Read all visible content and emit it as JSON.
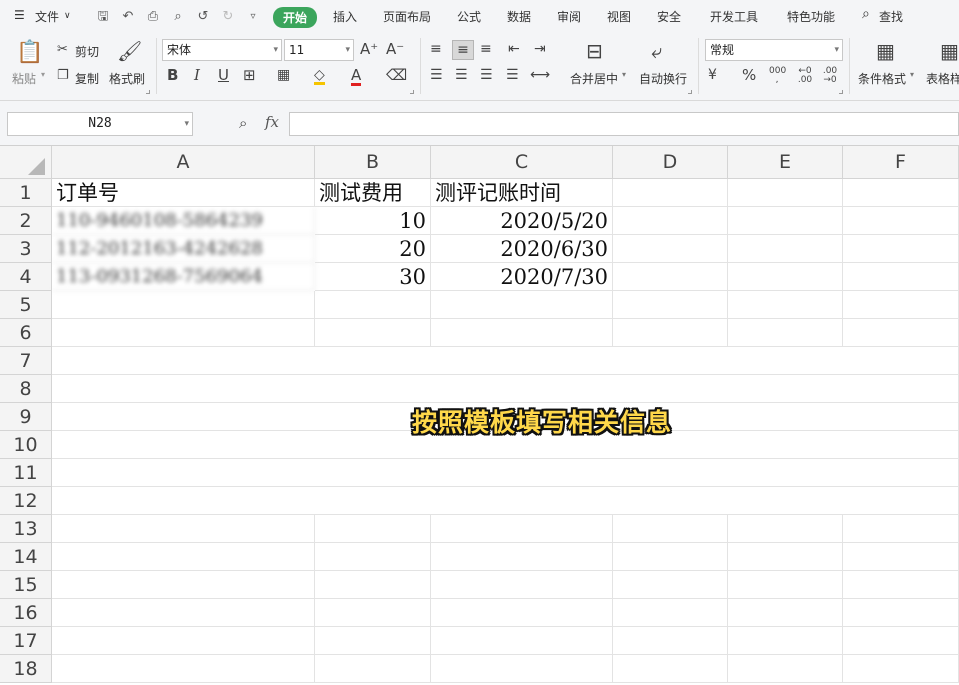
{
  "menu": {
    "file": "文件",
    "tabs": [
      "开始",
      "插入",
      "页面布局",
      "公式",
      "数据",
      "审阅",
      "视图",
      "安全",
      "开发工具",
      "特色功能"
    ],
    "active_tab": "开始",
    "search": "查找"
  },
  "ribbon": {
    "paste": "粘贴",
    "cut": "剪切",
    "copy": "复制",
    "format_painter": "格式刷",
    "font_name": "宋体",
    "font_size": "11",
    "merge_center": "合并居中",
    "wrap_text": "自动换行",
    "number_format": "常规",
    "conditional_format": "条件格式",
    "table_style": "表格样"
  },
  "formula_bar": {
    "name_box": "N28",
    "fx": "fx",
    "formula": ""
  },
  "sheet": {
    "columns": [
      "A",
      "B",
      "C",
      "D",
      "E",
      "F"
    ],
    "rows": [
      "1",
      "2",
      "3",
      "4",
      "5",
      "6",
      "7",
      "8",
      "9",
      "10",
      "11",
      "12",
      "13",
      "14",
      "15",
      "16",
      "17",
      "18"
    ],
    "header": [
      "订单号",
      "测试费用",
      "测评记账时间"
    ],
    "data": [
      {
        "order": "110-9460108-5864239",
        "fee": "10",
        "date": "2020/5/20"
      },
      {
        "order": "112-2012163-4242628",
        "fee": "20",
        "date": "2020/6/30"
      },
      {
        "order": "113-0931268-7569064",
        "fee": "30",
        "date": "2020/7/30"
      }
    ]
  },
  "overlay_caption": "按照模板填写相关信息"
}
